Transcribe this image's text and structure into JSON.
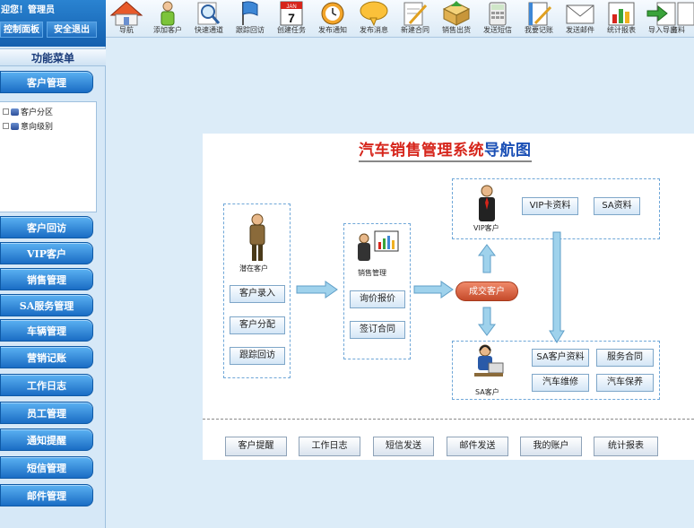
{
  "header": {
    "welcome": "迎您！管理员",
    "control_panel": "控制面板",
    "logout": "安全退出"
  },
  "sidebar": {
    "title": "功能菜单",
    "customer_mgmt": "客户管理",
    "tree": [
      "客户分区",
      "意向级别"
    ],
    "items": [
      "客户回访",
      "VIP客户",
      "销售管理",
      "SA服务管理",
      "车辆管理",
      "营销记账",
      "工作日志",
      "员工管理",
      "通知提醒",
      "短信管理",
      "邮件管理"
    ]
  },
  "toolbar": {
    "items": [
      {
        "label": "导航",
        "icon": "home-icon"
      },
      {
        "label": "添加客户",
        "icon": "add-customer-icon"
      },
      {
        "label": "快速通道",
        "icon": "magnifier-icon"
      },
      {
        "label": "跟踪回访",
        "icon": "flag-icon"
      },
      {
        "label": "创建任务",
        "icon": "calendar-icon",
        "calendar_month": "JAN",
        "calendar_day": "7"
      },
      {
        "label": "发布通知",
        "icon": "alarm-clock-icon"
      },
      {
        "label": "发布消息",
        "icon": "speech-bubble-icon"
      },
      {
        "label": "新建合同",
        "icon": "pencil-document-icon"
      },
      {
        "label": "销售出货",
        "icon": "box-icon"
      },
      {
        "label": "发送短信",
        "icon": "calculator-icon"
      },
      {
        "label": "我要记账",
        "icon": "notebook-pencil-icon"
      },
      {
        "label": "发送邮件",
        "icon": "envelope-icon"
      },
      {
        "label": "统计报表",
        "icon": "bar-chart-icon"
      },
      {
        "label": "导入导出",
        "icon": "import-export-icon"
      },
      {
        "label": "资料",
        "icon": "document-icon"
      }
    ]
  },
  "nav": {
    "title_red": "汽车销售管理系统",
    "title_blue": "导航图",
    "potential_customer": "潜在客户",
    "customer_entry": "客户录入",
    "customer_assign": "客户分配",
    "track_visit": "跟踪回访",
    "sales_mgmt": "销售管理",
    "price_inquiry": "询价报价",
    "sign_contract": "签订合同",
    "deal_customer": "成交客户",
    "vip_customer": "VIP客户",
    "vip_card": "VIP卡资料",
    "sa_data": "SA资料",
    "sa_customer": "SA客户",
    "sa_customer_data": "SA客户资料",
    "service_contract": "服务合同",
    "car_repair": "汽车维修",
    "car_maintenance": "汽车保养",
    "bottom": [
      "客户提醒",
      "工作日志",
      "短信发送",
      "邮件发送",
      "我的账户",
      "统计报表"
    ]
  },
  "colors": {
    "accent_blue": "#1a6cc4",
    "title_red": "#d6251b",
    "title_blue": "#1a4fb5",
    "deal_orange": "#d0603c",
    "arrow_blue": "#8fcae6"
  }
}
